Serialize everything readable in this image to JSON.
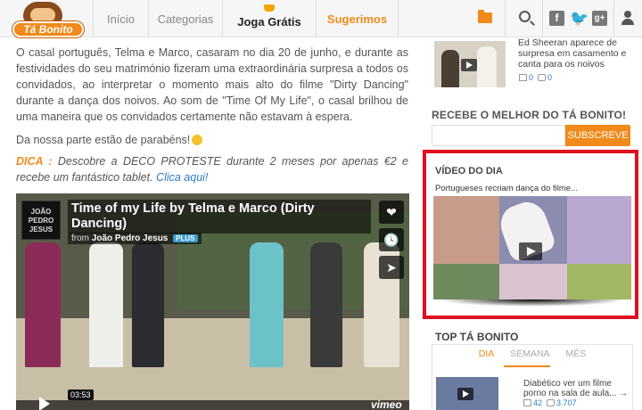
{
  "brand": {
    "logo_text": "Tá Bonito"
  },
  "nav": {
    "items": [
      {
        "label": "Início"
      },
      {
        "label": "Categorias"
      },
      {
        "label": "Joga Grátis"
      },
      {
        "label": "Sugerimos"
      }
    ],
    "icons": [
      "folder-icon",
      "search-icon",
      "facebook-icon",
      "twitter-icon",
      "google-plus-icon",
      "user-icon"
    ]
  },
  "article": {
    "paragraph": "O casal português, Telma e Marco, casaram no dia 20 de junho, e durante as festividades do seu matrimónio fizeram uma extraordinária surpresa a todos os convidados, ao interpretar o momento mais alto do filme \"Dirty Dancing\" durante a dança dos noivos. Ao som de \"Time Of My Life\", o casal brilhou de uma maneira que os convidados certamente não estavam à espera.",
    "congrats": "Da nossa parte estão de parabéns!",
    "dica_label": "DICA :",
    "dica_text": "Descobre a DECO PROTESTE durante 2 meses por apenas €2 e recebe um fantástico tablet.",
    "dica_link": "Clica aqui!"
  },
  "video": {
    "title": "Time of my Life by Telma e Marco (Dirty Dancing)",
    "from_label": "from",
    "author": "João Pedro Jesus",
    "badge": "PLUS",
    "uploader_thumb_text": "JOÃO PEDRO JESUS",
    "time": "03:53",
    "provider": "vimeo"
  },
  "sidebar": {
    "related": {
      "title": "Ed Sheeran aparece de surpresa em casamento e canta para os noivos",
      "likes": "0",
      "comments": "0"
    },
    "newsletter": {
      "heading": "RECEBE O MELHOR DO TÁ BONITO!",
      "placeholder": "",
      "button": "SUBSCREVE"
    },
    "video_do_dia": {
      "heading": "VÍDEO DO DIA",
      "subtitle": "Portugueses recriam dança do filme..."
    },
    "top": {
      "heading": "TOP TÁ BONITO",
      "tabs": [
        "DIA",
        "SEMANA",
        "MÊS"
      ],
      "item_title": "Diabético ver um filme porno na sala de aula... →",
      "likes": "42",
      "views": "3.707"
    }
  },
  "colors": {
    "accent": "#f08a1a",
    "highlight_border": "#e0101e",
    "link": "#2a7cc6"
  }
}
